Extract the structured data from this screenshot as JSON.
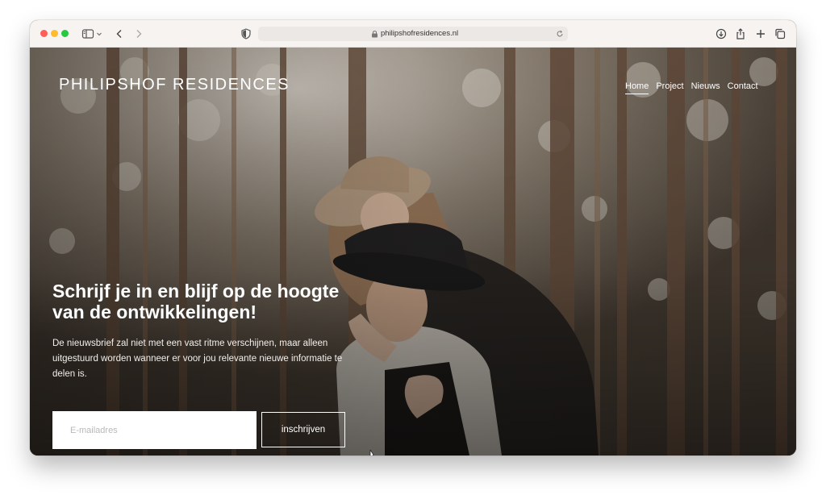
{
  "browser": {
    "url": "philipshofresidences.nl",
    "icons": [
      "sidebar-icon",
      "chevron-down-icon",
      "back-icon",
      "forward-icon",
      "shield-icon",
      "lock-icon",
      "reload-icon",
      "download-icon",
      "share-icon",
      "new-tab-icon",
      "tabs-overview-icon"
    ]
  },
  "site": {
    "logo": "PHILIPSHOF RESIDENCES",
    "nav": [
      {
        "label": "Home",
        "active": true
      },
      {
        "label": "Project",
        "active": false
      },
      {
        "label": "Nieuws",
        "active": false
      },
      {
        "label": "Contact",
        "active": false
      }
    ],
    "headline": "Schrijf je in en blijf op de hoogte van de ontwikkelingen!",
    "intro": "De nieuwsbrief zal niet met een vast ritme verschijnen, maar alleen uitgestuurd worden wanneer er voor jou relevante nieuwe informatie te delen is.",
    "email_placeholder": "E-mailadres",
    "subscribe_label": "inschrijven"
  },
  "colors": {
    "toolbar": "#f6f3f1",
    "accent_white": "#ffffff",
    "hero_overlay": "#3d342b"
  }
}
